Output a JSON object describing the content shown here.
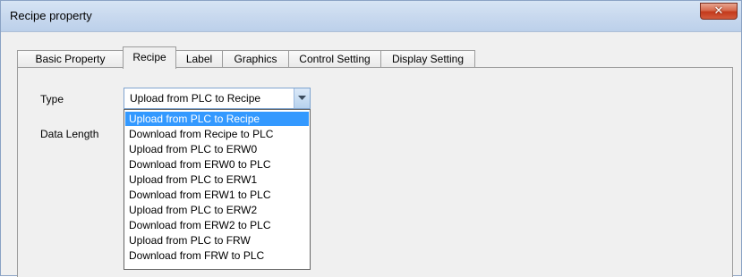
{
  "window": {
    "title": "Recipe property"
  },
  "tabs": [
    {
      "label": "Basic Property"
    },
    {
      "label": "Recipe"
    },
    {
      "label": "Label"
    },
    {
      "label": "Graphics"
    },
    {
      "label": "Control Setting"
    },
    {
      "label": "Display Setting"
    }
  ],
  "active_tab": "Recipe",
  "form": {
    "type_label": "Type",
    "data_length_label": "Data Length",
    "type_value": "Upload from PLC to Recipe"
  },
  "dropdown": {
    "options": [
      "Upload from PLC to Recipe",
      "Download from Recipe to PLC",
      "Upload from PLC to ERW0",
      "Download from ERW0 to PLC",
      "Upload from PLC to ERW1",
      "Download from ERW1 to PLC",
      "Upload from PLC to ERW2",
      "Download from ERW2 to PLC",
      "Upload from PLC to FRW",
      "Download from FRW to PLC"
    ],
    "selected_index": 0
  },
  "colors": {
    "selection": "#3399ff",
    "close_button": "#c43a1c",
    "titlebar": "#c7d8ee"
  },
  "icons": {
    "close": "close-icon",
    "dropdown": "chevron-down-icon"
  }
}
